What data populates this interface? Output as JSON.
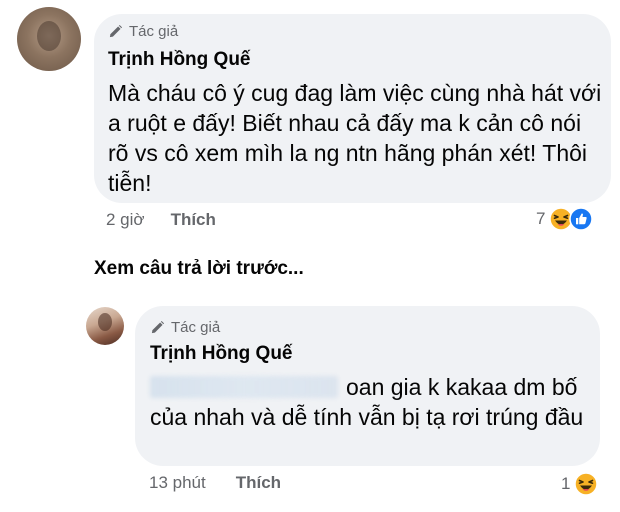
{
  "comments": [
    {
      "author_tag": "Tác giả",
      "author_name": "Trịnh Hồng Quế",
      "text": "Mà cháu cô ý cug đag làm việc cùng nhà hát với a ruột e đấy! Biết nhau cả đấy ma k cản cô nói rõ vs cô xem mìh la ng ntn hãng phán xét! Thôi tiễn!",
      "time": "2 giờ",
      "like_label": "Thích",
      "reaction_count": "7",
      "reactions": [
        "haha-icon",
        "like-icon"
      ]
    },
    {
      "author_tag": "Tác giả",
      "author_name": "Trịnh Hồng Quế",
      "text": "oan gia k kakaa dm bố của nhah và dễ tính vẫn bị tạ rơi trúng đầu",
      "time": "13 phút",
      "like_label": "Thích",
      "reaction_count": "1",
      "reactions": [
        "haha-icon"
      ]
    }
  ],
  "view_previous_replies": "Xem câu trả lời trước...",
  "colors": {
    "bubble": "#f0f2f5",
    "muted_text": "#65676b",
    "text": "#050505",
    "like_blue": "#1877f2",
    "haha_yellow": "#f7b125"
  }
}
